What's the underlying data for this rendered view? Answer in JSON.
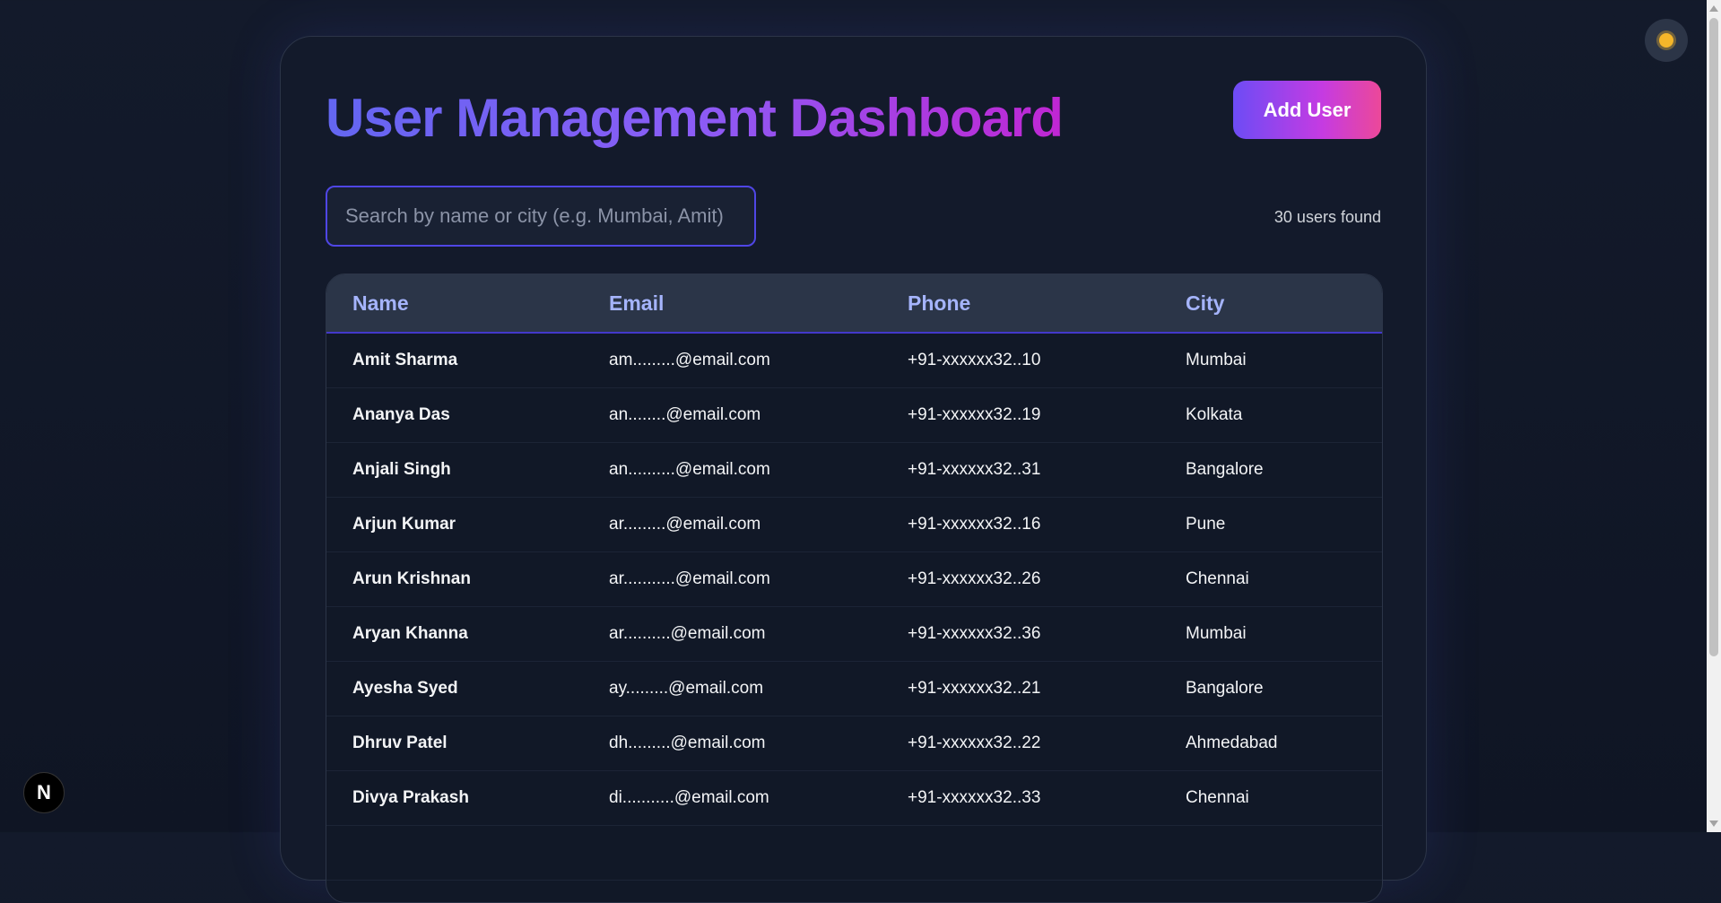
{
  "header": {
    "title": "User Management Dashboard",
    "add_button_label": "Add User"
  },
  "search": {
    "placeholder": "Search by name or city (e.g. Mumbai, Amit)",
    "value": ""
  },
  "results_count": "30 users found",
  "table": {
    "columns": [
      "Name",
      "Email",
      "Phone",
      "City"
    ],
    "rows": [
      {
        "name": "Amit Sharma",
        "email": "am.........@email.com",
        "phone": "+91-xxxxxx32..10",
        "city": "Mumbai"
      },
      {
        "name": "Ananya Das",
        "email": "an........@email.com",
        "phone": "+91-xxxxxx32..19",
        "city": "Kolkata"
      },
      {
        "name": "Anjali Singh",
        "email": "an..........@email.com",
        "phone": "+91-xxxxxx32..31",
        "city": "Bangalore"
      },
      {
        "name": "Arjun Kumar",
        "email": "ar.........@email.com",
        "phone": "+91-xxxxxx32..16",
        "city": "Pune"
      },
      {
        "name": "Arun Krishnan",
        "email": "ar...........@email.com",
        "phone": "+91-xxxxxx32..26",
        "city": "Chennai"
      },
      {
        "name": "Aryan Khanna",
        "email": "ar..........@email.com",
        "phone": "+91-xxxxxx32..36",
        "city": "Mumbai"
      },
      {
        "name": "Ayesha Syed",
        "email": "ay.........@email.com",
        "phone": "+91-xxxxxx32..21",
        "city": "Bangalore"
      },
      {
        "name": "Dhruv Patel",
        "email": "dh.........@email.com",
        "phone": "+91-xxxxxx32..22",
        "city": "Ahmedabad"
      },
      {
        "name": "Divya Prakash",
        "email": "di...........@email.com",
        "phone": "+91-xxxxxx32..33",
        "city": "Chennai"
      },
      {
        "name": "",
        "email": "",
        "phone": "",
        "city": ""
      }
    ]
  },
  "theme_toggle": {
    "icon": "sun-icon",
    "color": "#f5b62a"
  },
  "dev_badge": {
    "label": "N"
  },
  "colors": {
    "background": "#131a2b",
    "accent_indigo": "#6366f1",
    "accent_pink": "#ec4899",
    "header_text": "#a5b4fc"
  }
}
